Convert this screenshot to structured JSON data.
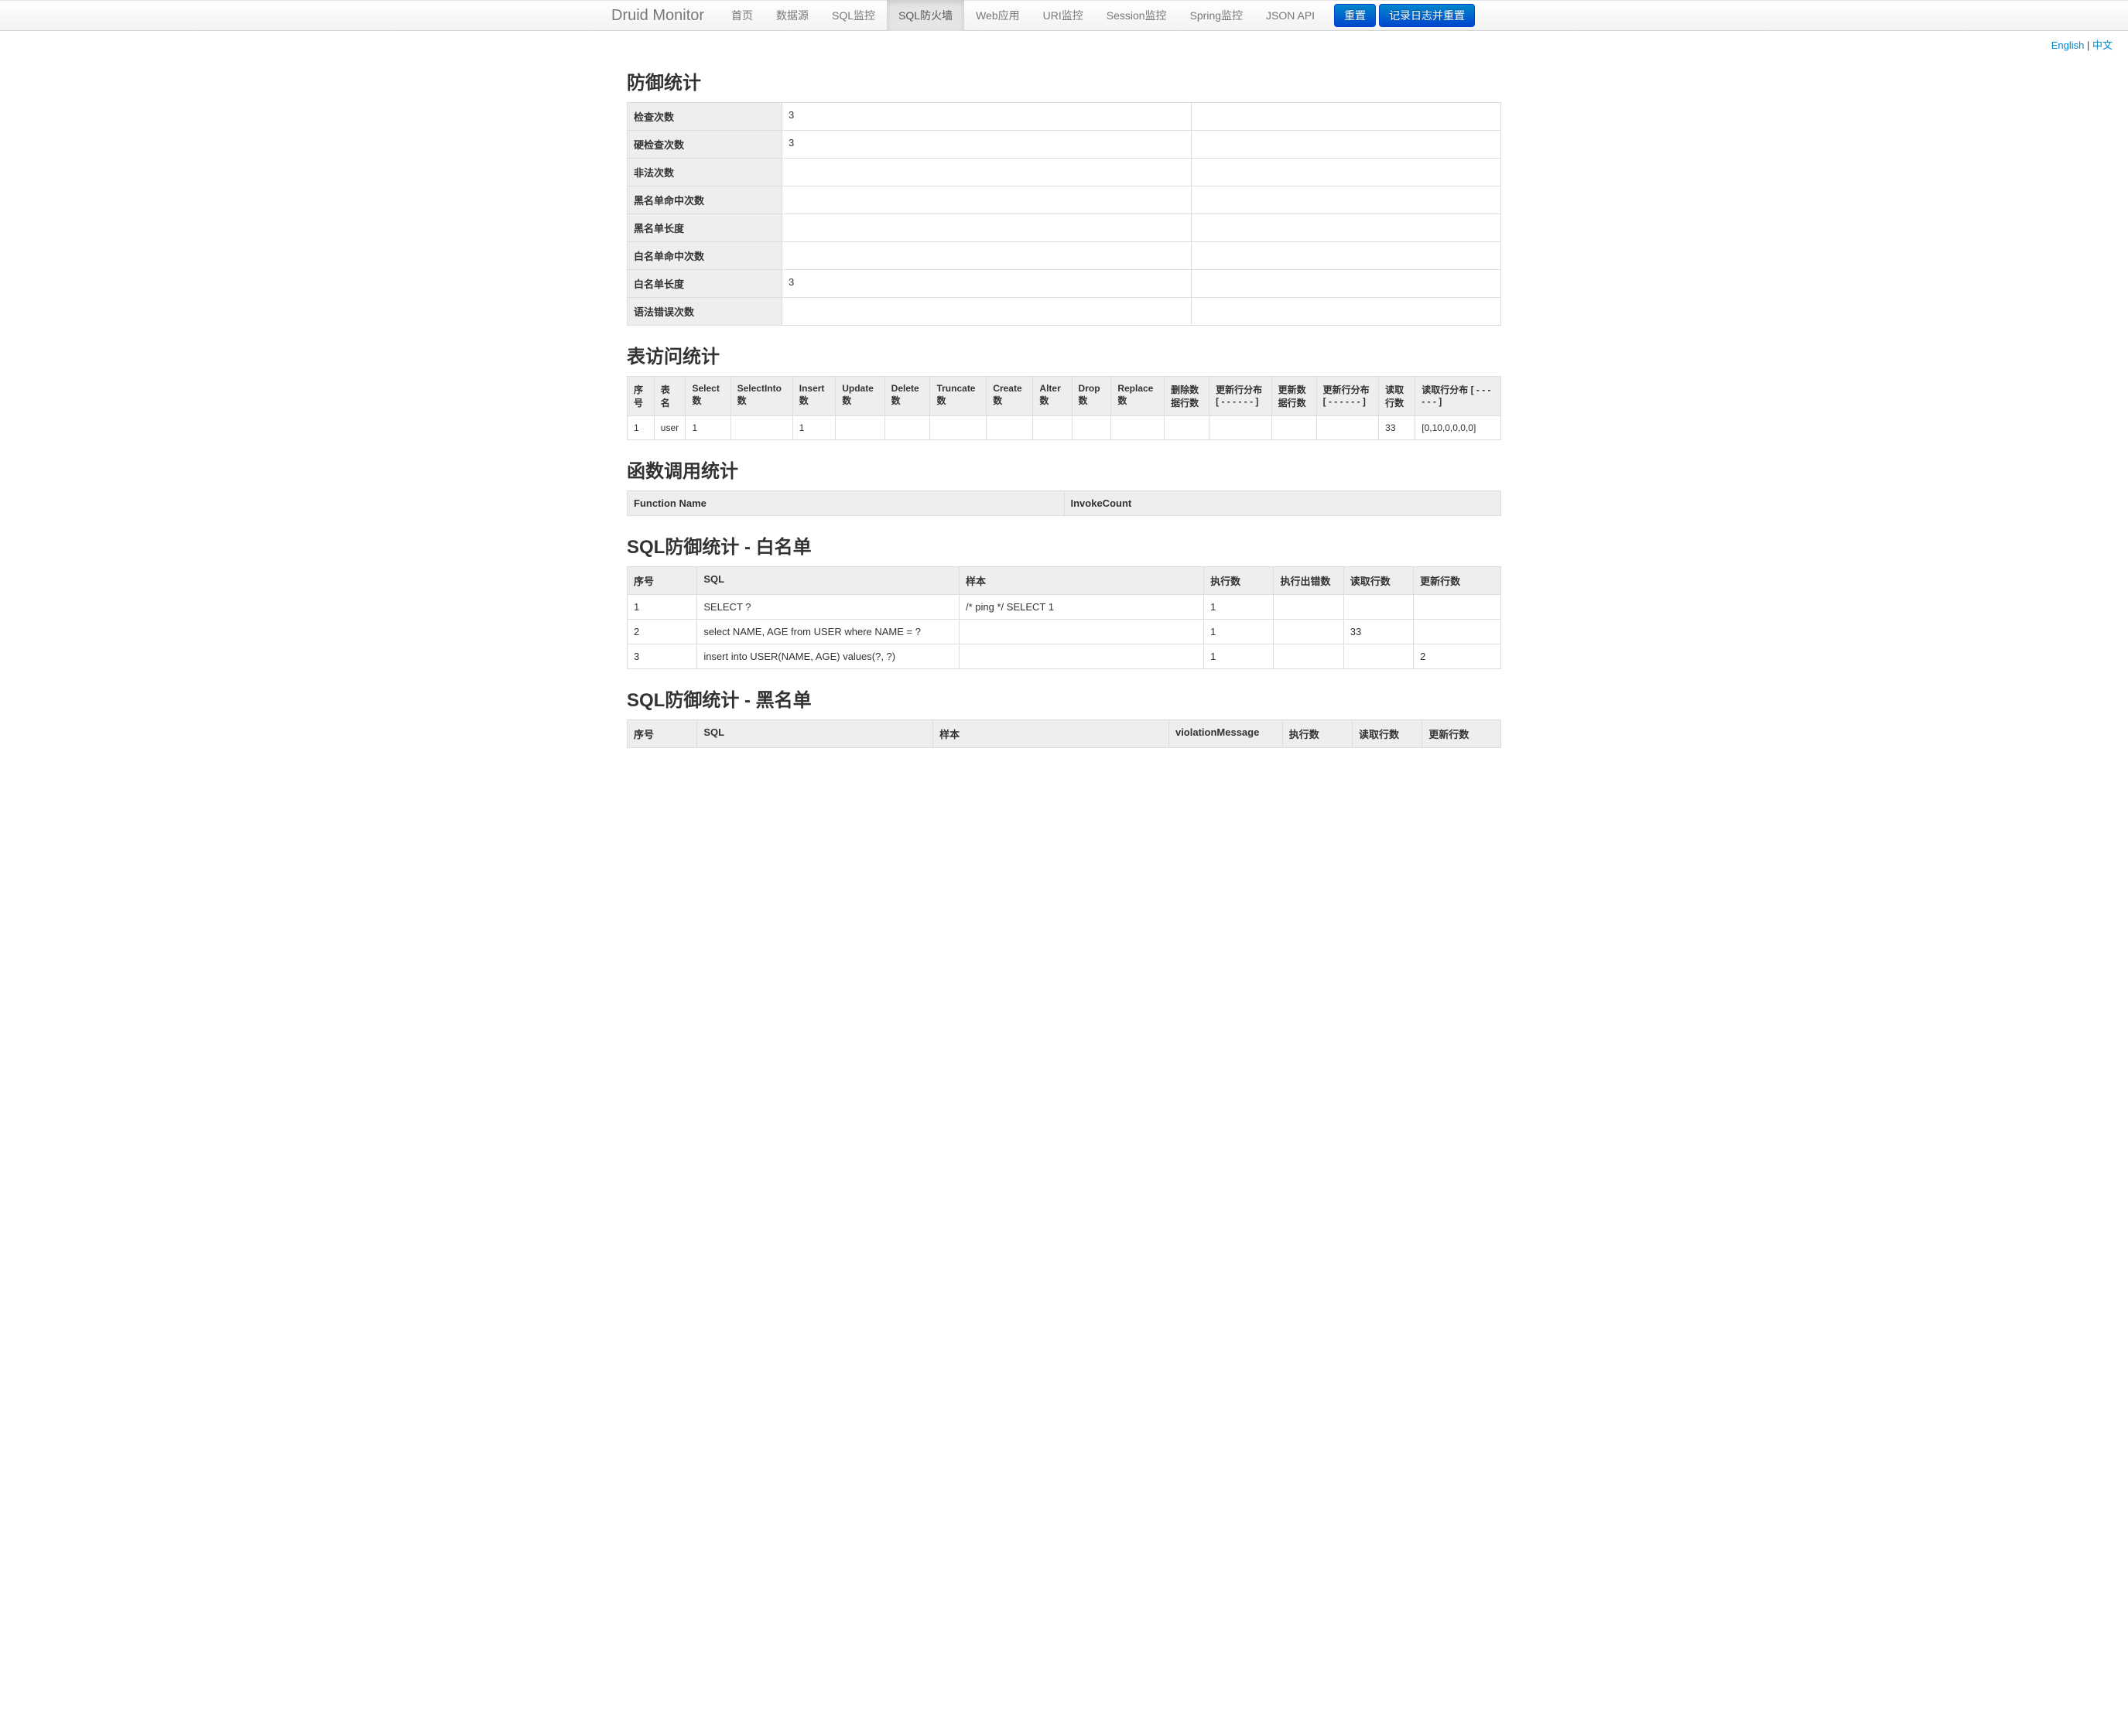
{
  "navbar": {
    "brand": "Druid Monitor",
    "items": [
      {
        "label": "首页"
      },
      {
        "label": "数据源"
      },
      {
        "label": "SQL监控"
      },
      {
        "label": "SQL防火墙",
        "active": true
      },
      {
        "label": "Web应用"
      },
      {
        "label": "URI监控"
      },
      {
        "label": "Session监控"
      },
      {
        "label": "Spring监控"
      },
      {
        "label": "JSON API"
      }
    ],
    "buttons": {
      "reset": "重置",
      "logReset": "记录日志并重置"
    }
  },
  "lang": {
    "english": "English",
    "separator": " | ",
    "chinese": "中文"
  },
  "sections": {
    "defense": {
      "title": "防御统计",
      "rows": [
        {
          "label": "检查次数",
          "value": "3",
          "extra": ""
        },
        {
          "label": "硬检查次数",
          "value": "3",
          "extra": ""
        },
        {
          "label": "非法次数",
          "value": "",
          "extra": ""
        },
        {
          "label": "黑名单命中次数",
          "value": "",
          "extra": ""
        },
        {
          "label": "黑名单长度",
          "value": "",
          "extra": ""
        },
        {
          "label": "白名单命中次数",
          "value": "",
          "extra": ""
        },
        {
          "label": "白名单长度",
          "value": "3",
          "extra": ""
        },
        {
          "label": "语法错误次数",
          "value": "",
          "extra": ""
        }
      ]
    },
    "tableAccess": {
      "title": "表访问统计",
      "headers": [
        "序号",
        "表名",
        "Select数",
        "SelectInto数",
        "Insert数",
        "Update数",
        "Delete数",
        "Truncate数",
        "Create数",
        "Alter数",
        "Drop数",
        "Replace数",
        "删除数据行数",
        "更新行分布 [ - - - - - - ]",
        "更新数据行数",
        "更新行分布 [ - - - - - - ]",
        "读取行数",
        "读取行分布 [ - - - - - - ]"
      ],
      "rows": [
        {
          "cells": [
            "1",
            "user",
            "1",
            "",
            "1",
            "",
            "",
            "",
            "",
            "",
            "",
            "",
            "",
            "",
            "",
            "",
            "33",
            "[0,10,0,0,0,0]"
          ]
        }
      ]
    },
    "functionCall": {
      "title": "函数调用统计",
      "headers": [
        "Function Name",
        "InvokeCount"
      ],
      "rows": []
    },
    "whitelist": {
      "title": "SQL防御统计 - 白名单",
      "headers": [
        "序号",
        "SQL",
        "样本",
        "执行数",
        "执行出错数",
        "读取行数",
        "更新行数"
      ],
      "rows": [
        {
          "cells": [
            "1",
            "SELECT ?",
            "/* ping */ SELECT 1",
            "1",
            "",
            "",
            ""
          ]
        },
        {
          "cells": [
            "2",
            "select NAME, AGE from USER where NAME = ?",
            "",
            "1",
            "",
            "33",
            ""
          ]
        },
        {
          "cells": [
            "3",
            "insert into USER(NAME, AGE) values(?, ?)",
            "",
            "1",
            "",
            "",
            "2"
          ]
        }
      ]
    },
    "blacklist": {
      "title": "SQL防御统计 - 黑名单",
      "headers": [
        "序号",
        "SQL",
        "样本",
        "violationMessage",
        "执行数",
        "读取行数",
        "更新行数"
      ],
      "rows": []
    }
  }
}
